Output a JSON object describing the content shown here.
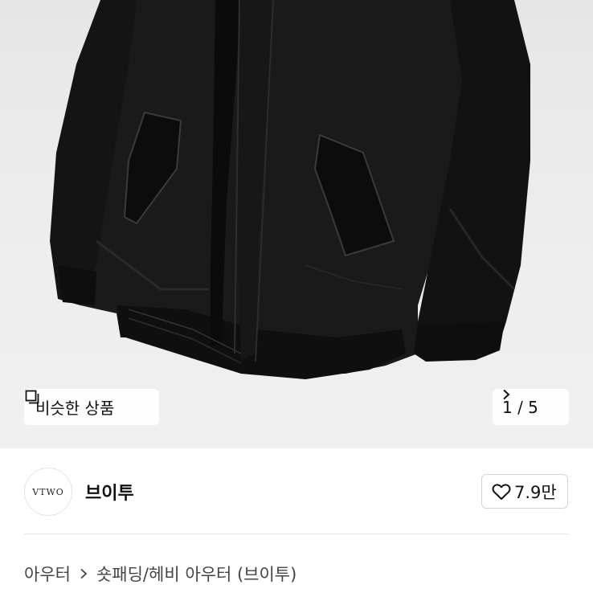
{
  "hero": {
    "similar_label": "비슷한 상품",
    "similar_icon": "copy-icon",
    "page_indicator": "1 / 5",
    "next_icon": "chevron-right-icon"
  },
  "seller": {
    "logo_text": "VTWO",
    "name": "브이투",
    "like_icon": "heart-outline-icon",
    "likes": "7.9만"
  },
  "breadcrumb": {
    "level1": "아우터",
    "separator_icon": "chevron-right-icon",
    "level2": "숏패딩/헤비 아우터 (브이투)"
  },
  "colors": {
    "hero_background": "#ebebeb",
    "product": "#141414",
    "divider": "#e6e6e6"
  }
}
